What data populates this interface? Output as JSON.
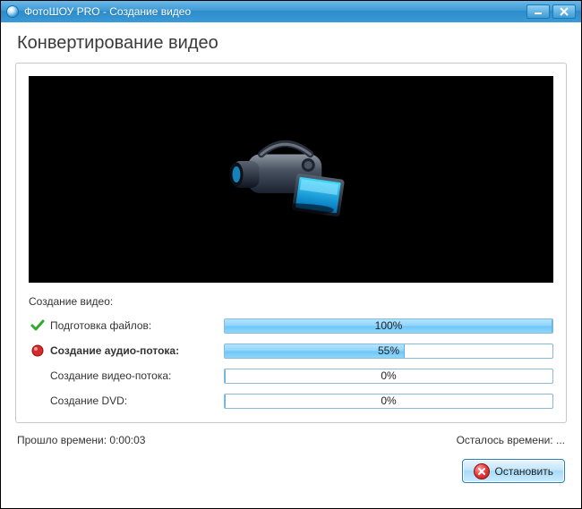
{
  "window": {
    "title": "ФотоШОУ PRO - Создание видео"
  },
  "page": {
    "title": "Конвертирование видео"
  },
  "progress_section": {
    "header": "Создание видео:",
    "steps": [
      {
        "label": "Подготовка файлов:",
        "percent": 100,
        "percent_text": "100%",
        "state": "done",
        "icon": "check-icon"
      },
      {
        "label": "Создание аудио-потока:",
        "percent": 55,
        "percent_text": "55%",
        "state": "active",
        "icon": "record-icon"
      },
      {
        "label": "Создание видео-потока:",
        "percent": 0,
        "percent_text": "0%",
        "state": "pending",
        "icon": ""
      },
      {
        "label": "Создание DVD:",
        "percent": 0,
        "percent_text": "0%",
        "state": "pending",
        "icon": ""
      }
    ]
  },
  "status": {
    "elapsed_label": "Прошло времени: ",
    "elapsed_value": "0:00:03",
    "remaining_label": "Осталось времени: ",
    "remaining_value": "..."
  },
  "buttons": {
    "stop": "Остановить"
  },
  "colors": {
    "titlebar_top": "#6bb8e8",
    "titlebar_bottom": "#3a9bd8",
    "progress_fill": "#8fd5fb",
    "progress_border": "#8bb9d9",
    "stop_red": "#e63a3a"
  }
}
